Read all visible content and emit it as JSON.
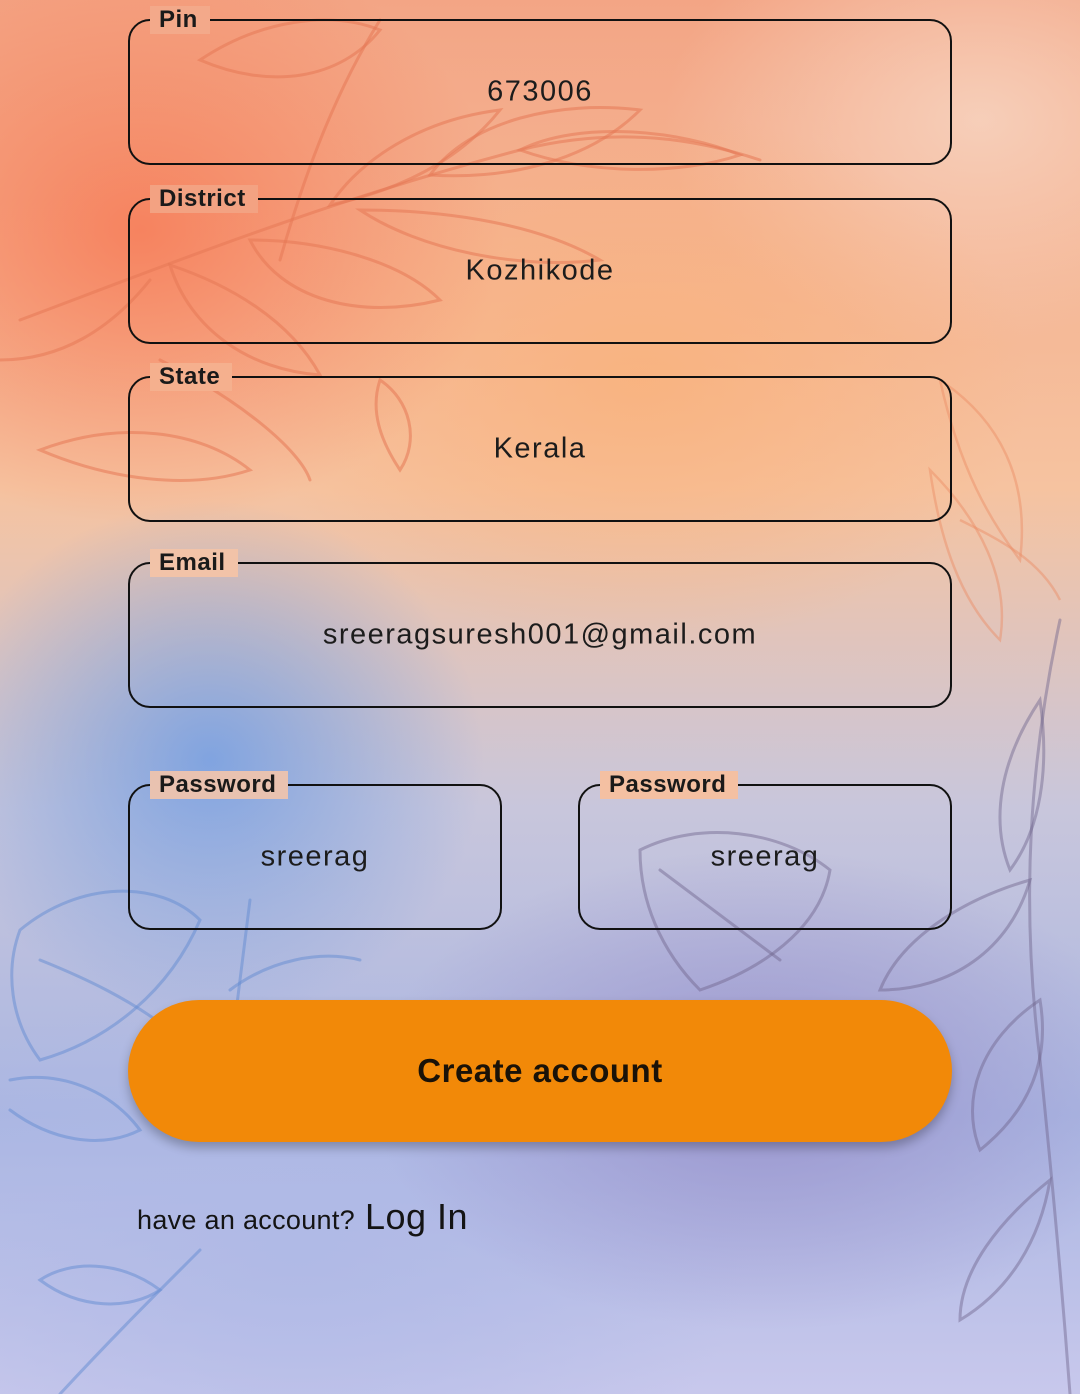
{
  "form": {
    "pin": {
      "label": "Pin",
      "value": "673006"
    },
    "district": {
      "label": "District",
      "value": "Kozhikode"
    },
    "state": {
      "label": "State",
      "value": "Kerala"
    },
    "email": {
      "label": "Email",
      "value": "sreeragsuresh001@gmail.com"
    },
    "password": {
      "label": "Password",
      "value": "sreerag"
    },
    "confirm_password": {
      "label": "Password",
      "value": "sreerag"
    }
  },
  "create_button": {
    "label": "Create account",
    "color": "#f28908"
  },
  "login": {
    "prompt": "have an account?",
    "link": "Log In"
  },
  "background": {
    "icon": "watercolor-floral-background"
  }
}
